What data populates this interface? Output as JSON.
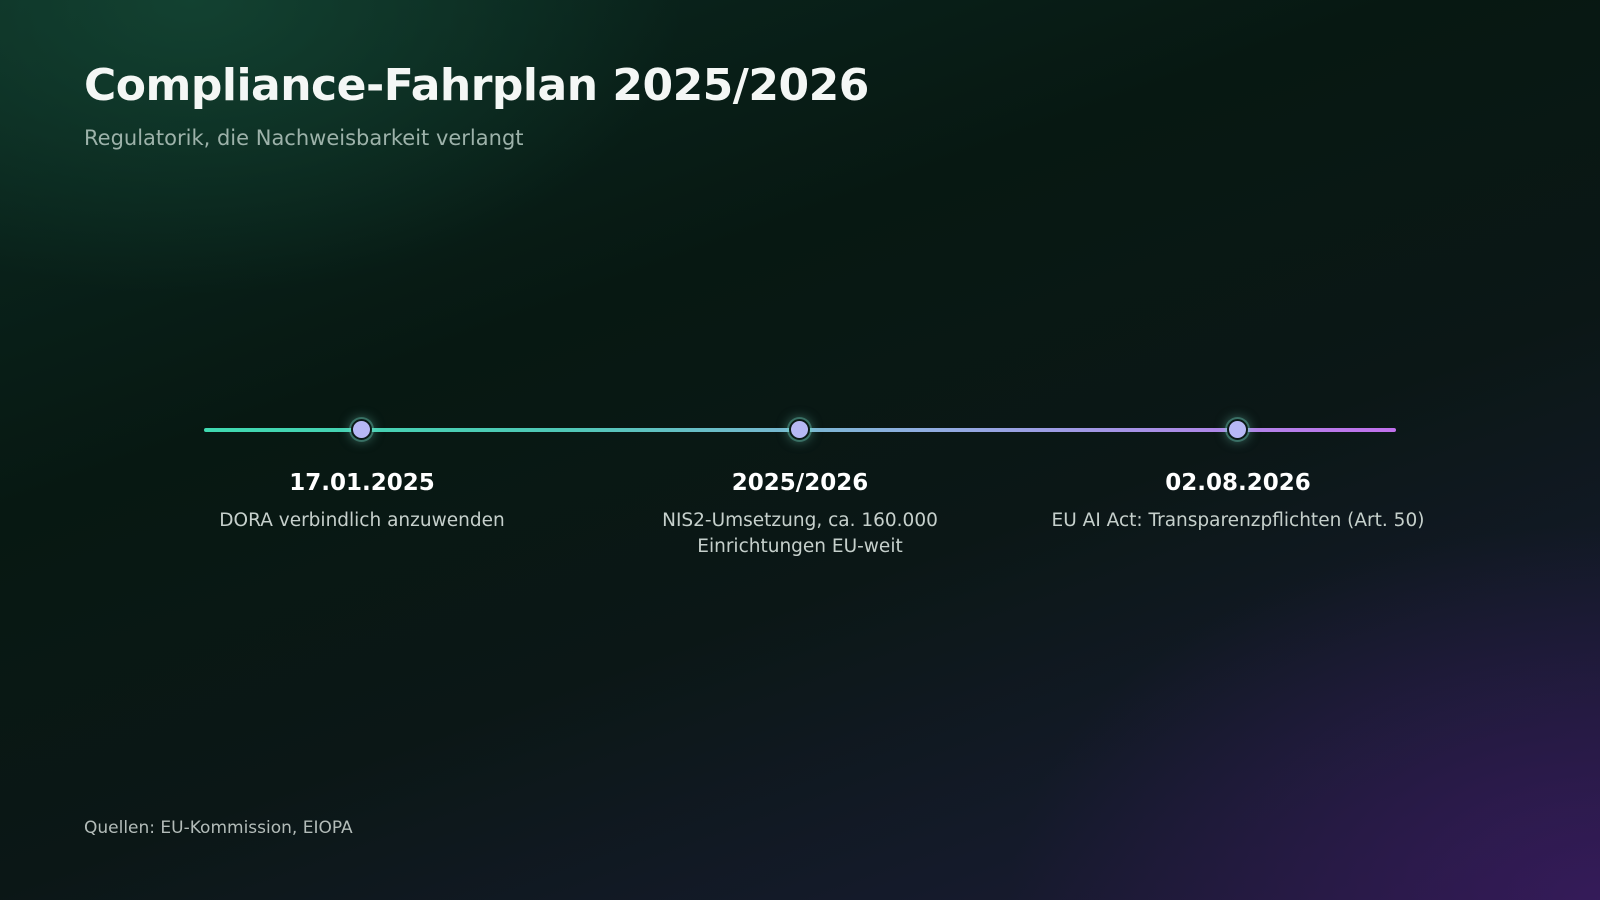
{
  "title": "Compliance-Fahrplan 2025/2026",
  "subtitle": "Regulatorik, die Nachweisbarkeit verlangt",
  "milestones": [
    {
      "date": "17.01.2025",
      "description": "DORA verbindlich anzuwenden"
    },
    {
      "date": "2025/2026",
      "description": "NIS2-Umsetzung, ca. 160.000 Einrichtungen EU-weit"
    },
    {
      "date": "02.08.2026",
      "description": "EU AI Act: Transparenzpflichten (Art. 50)"
    }
  ],
  "source": "Quellen: EU-Kommission, EIOPA",
  "colors": {
    "timeline_start": "#3fd9b0",
    "timeline_end": "#c170ec",
    "dot": "#b7b8f5",
    "background_top": "#0b2a21",
    "background_bottom": "#1f1838"
  }
}
